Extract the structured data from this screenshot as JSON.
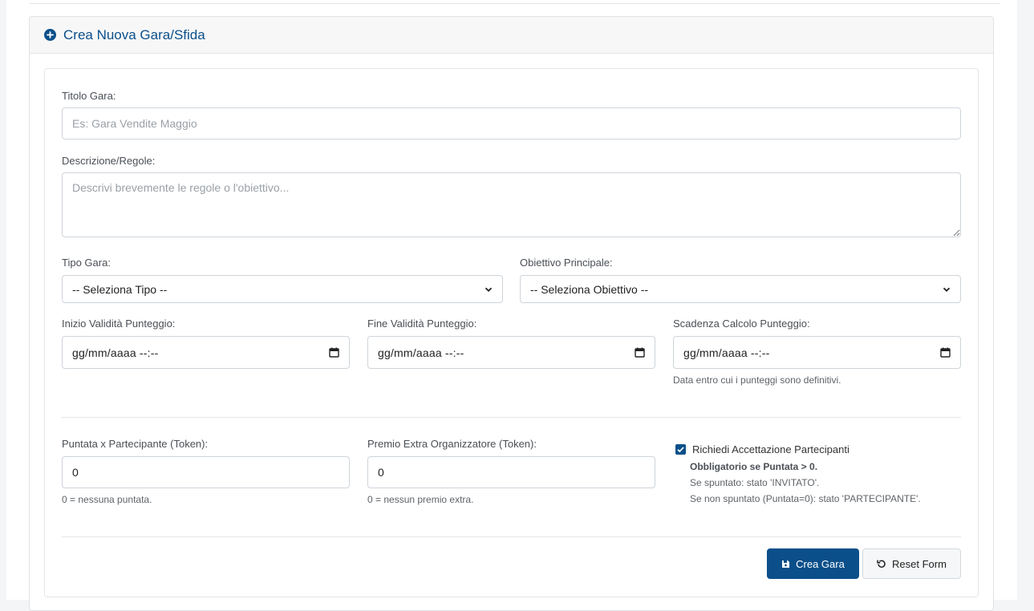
{
  "card": {
    "title": "Crea Nuova Gara/Sfida"
  },
  "form": {
    "titolo": {
      "label": "Titolo Gara:",
      "placeholder": "Es: Gara Vendite Maggio",
      "value": ""
    },
    "descrizione": {
      "label": "Descrizione/Regole:",
      "placeholder": "Descrivi brevemente le regole o l'obiettivo...",
      "value": ""
    },
    "tipo": {
      "label": "Tipo Gara:",
      "selected": "-- Seleziona Tipo --"
    },
    "obiettivo": {
      "label": "Obiettivo Principale:",
      "selected": "-- Seleziona Obiettivo --"
    },
    "inizio": {
      "label": "Inizio Validità Punteggio:",
      "value": "gg/mm/aaaa --:--"
    },
    "fine": {
      "label": "Fine Validità Punteggio:",
      "value": "gg/mm/aaaa --:--"
    },
    "scadenza": {
      "label": "Scadenza Calcolo Punteggio:",
      "value": "gg/mm/aaaa --:--",
      "help": "Data entro cui i punteggi sono definitivi."
    },
    "puntata": {
      "label": "Puntata x Partecipante (Token):",
      "value": "0",
      "help": "0 = nessuna puntata."
    },
    "premio": {
      "label": "Premio Extra Organizzatore (Token):",
      "value": "0",
      "help": "0 = nessun premio extra."
    },
    "accettazione": {
      "label": "Richiedi Accettazione Partecipanti",
      "checked": true,
      "note_bold": "Obbligatorio se Puntata > 0.",
      "note_1": "Se spuntato: stato 'INVITATO'.",
      "note_2": "Se non spuntato (Puntata=0): stato 'PARTECIPANTE'."
    }
  },
  "buttons": {
    "create": "Crea Gara",
    "reset": "Reset Form"
  },
  "colors": {
    "primary": "#0b4f8a",
    "border": "#ced4da"
  },
  "icons": [
    "plus-circle-icon",
    "chevron-down-icon",
    "calendar-icon",
    "check-icon",
    "save-icon",
    "undo-icon"
  ]
}
